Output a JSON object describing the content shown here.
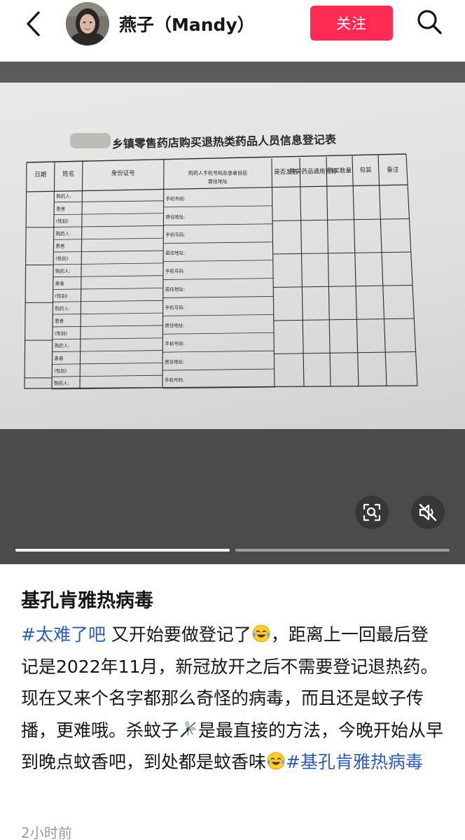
{
  "header": {
    "back_icon": "chevron-left-icon",
    "username": "燕子（Mandy）",
    "follow_label": "关注",
    "search_icon": "search-icon"
  },
  "media": {
    "form": {
      "title": "乡镇零售药店购买退热类药品人员信息登记表",
      "headers": [
        "日期",
        "姓名",
        "身份证号",
        "购药人手机号码及患者目前居住地址",
        "是否发热",
        "购买药品通用名称",
        "购买数量",
        "包装",
        "备注"
      ],
      "name_column_rows": [
        "购药人:",
        "患者",
        "(性别)",
        "购药人:",
        "患者",
        "(性别)",
        "购药人:",
        "患者",
        "(性别)",
        "购药人:",
        "患者",
        "(性别)",
        "购药人:",
        "患者",
        "(性别)",
        "购药人:"
      ],
      "address_column_rows": [
        "手机号码:",
        "居住地址:",
        "手机号码:",
        "居住地址:",
        "手机号码:",
        "居住地址:",
        "手机号码:",
        "居住地址:",
        "手机号码:",
        "居住地址:",
        "手机号码:"
      ]
    },
    "scan_icon": "image-search-icon",
    "mute_icon": "volume-mute-icon",
    "slides_total": 2,
    "slide_current": 1
  },
  "post": {
    "title": "基孔肯雅热病毒",
    "hashtag1": "#太难了吧",
    "text1": " 又开始要做登记了",
    "text2": "，距离上一回最后登记是2022年11月，新冠放开之后不需要登记退热药。现在又来个名字都那么奇怪的病毒，而且还是蚊子传播，更难哦。杀蚊子",
    "text3": "是最直接的方法，今晚开始从早到晚点蚊香吧，到处都是蚊香味",
    "hashtag2": "#基孔肯雅热病毒",
    "emoji_laugh": "tears-of-joy-emoji",
    "emoji_mosquito": "mosquito-emoji",
    "timestamp": "2小时前"
  },
  "colors": {
    "accent": "#fe2c55",
    "hashtag": "#2f5dab"
  }
}
